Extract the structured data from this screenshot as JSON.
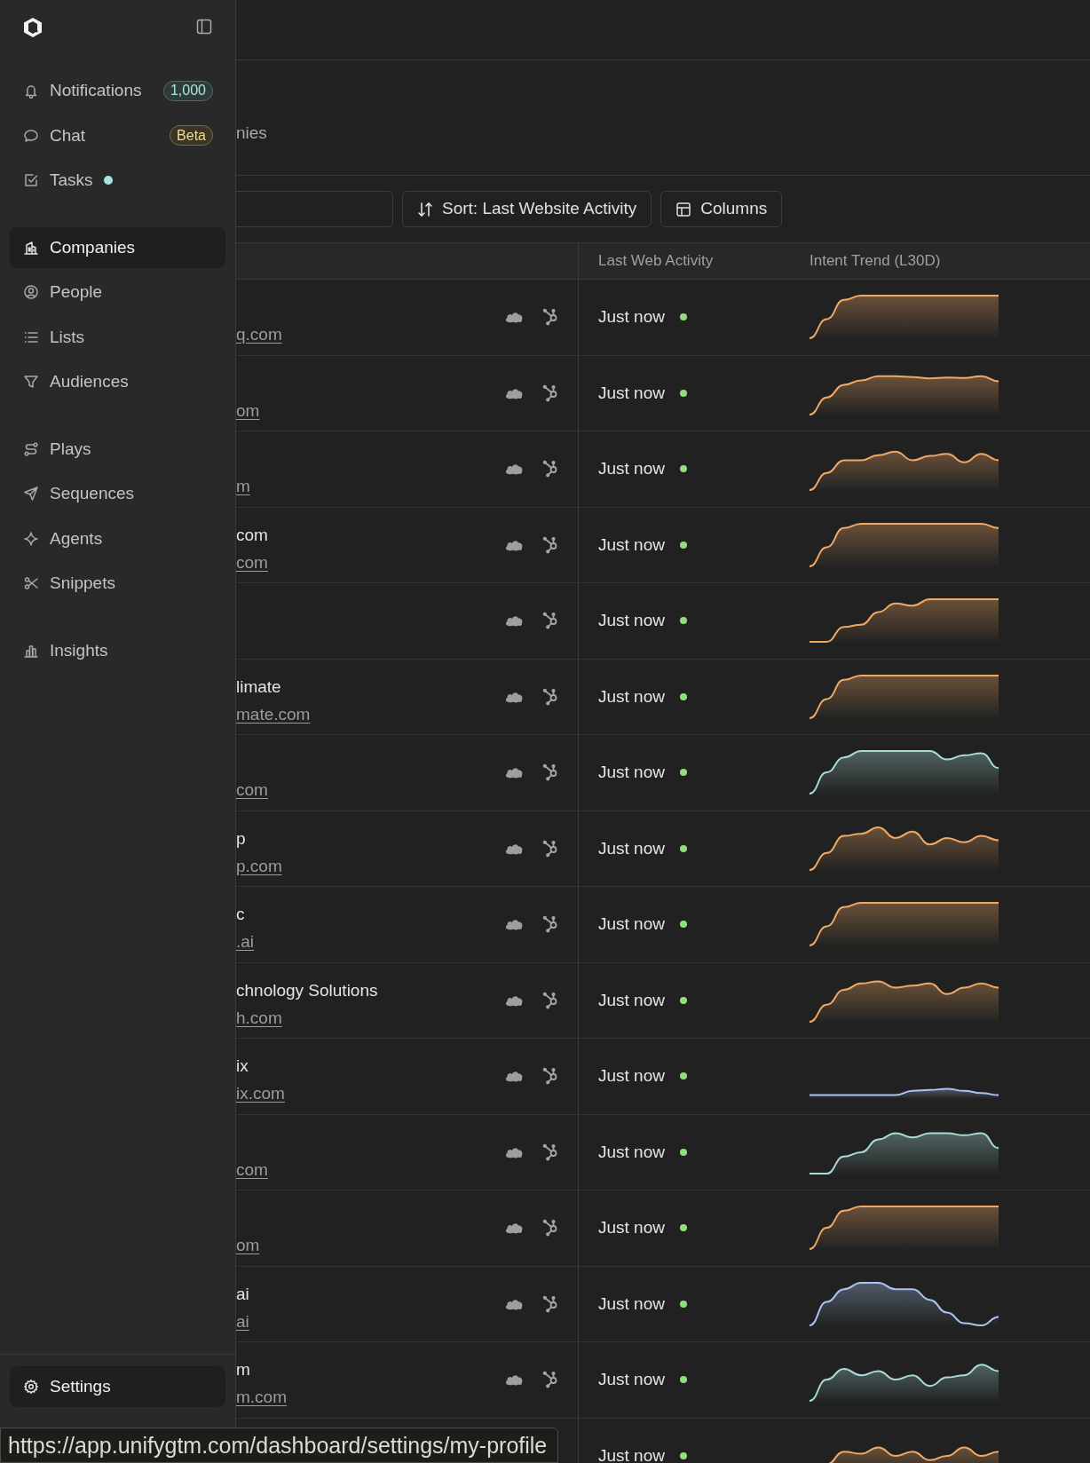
{
  "sidebar": {
    "groups": [
      [
        {
          "label": "Notifications",
          "selected": false,
          "badge": {
            "text": "1,000",
            "kind": "count"
          }
        },
        {
          "label": "Chat",
          "selected": false,
          "badge": {
            "text": "Beta",
            "kind": "beta"
          }
        },
        {
          "label": "Tasks",
          "selected": false,
          "unread": true
        }
      ],
      [
        {
          "label": "Companies",
          "selected": true
        },
        {
          "label": "People",
          "selected": false
        },
        {
          "label": "Lists",
          "selected": false
        },
        {
          "label": "Audiences",
          "selected": false
        }
      ],
      [
        {
          "label": "Plays",
          "selected": false
        },
        {
          "label": "Sequences",
          "selected": false
        },
        {
          "label": "Agents",
          "selected": false
        },
        {
          "label": "Snippets",
          "selected": false
        }
      ],
      [
        {
          "label": "Insights",
          "selected": false
        }
      ]
    ],
    "footer": {
      "label": "Settings",
      "selected": true
    }
  },
  "page": {
    "tab_fragment": "nies"
  },
  "toolbar": {
    "sort_button": "Sort: Last Website Activity",
    "columns_button": "Columns"
  },
  "table": {
    "columns": [
      "Last Web Activity",
      "Intent Trend (L30D)"
    ],
    "rows": [
      {
        "domain": "q.com",
        "last_activity": "Just now",
        "active": true,
        "trend": {
          "color": "#f0a865"
        }
      },
      {
        "domain": "om",
        "last_activity": "Just now",
        "active": true,
        "trend": {
          "color": "#f0a865"
        }
      },
      {
        "domain": "m",
        "last_activity": "Just now",
        "active": true,
        "trend": {
          "color": "#f0a865"
        }
      },
      {
        "name": "com",
        "domain": "com",
        "last_activity": "Just now",
        "active": true,
        "trend": {
          "color": "#f0a865"
        }
      },
      {
        "last_activity": "Just now",
        "active": true,
        "trend": {
          "color": "#f0a865"
        }
      },
      {
        "name": "limate",
        "domain": "mate.com",
        "last_activity": "Just now",
        "active": true,
        "trend": {
          "color": "#f0a865"
        }
      },
      {
        "domain": "com",
        "last_activity": "Just now",
        "active": true,
        "trend": {
          "color": "#a8dcd8"
        }
      },
      {
        "name": "p",
        "domain": "p.com",
        "last_activity": "Just now",
        "active": true,
        "trend": {
          "color": "#f0a865"
        }
      },
      {
        "name": "c",
        "domain": ".ai",
        "last_activity": "Just now",
        "active": true,
        "trend": {
          "color": "#f0a865"
        }
      },
      {
        "name": "chnology Solutions",
        "domain": "h.com",
        "last_activity": "Just now",
        "active": true,
        "trend": {
          "color": "#f0a865"
        }
      },
      {
        "name": "ix",
        "domain": "ix.com",
        "last_activity": "Just now",
        "active": true,
        "trend": {
          "color": "#a9c4f0"
        }
      },
      {
        "domain": "com",
        "last_activity": "Just now",
        "active": true,
        "trend": {
          "color": "#a8dcd8"
        }
      },
      {
        "domain": "om",
        "last_activity": "Just now",
        "active": true,
        "trend": {
          "color": "#f0a865"
        }
      },
      {
        "name": "ai",
        "domain": "ai",
        "last_activity": "Just now",
        "active": true,
        "trend": {
          "color": "#a9c4f0"
        }
      },
      {
        "name": "m",
        "domain": "m.com",
        "last_activity": "Just now",
        "active": true,
        "trend": {
          "color": "#a8dcd8"
        }
      },
      {
        "last_activity": "Just now",
        "active": true,
        "trend": {
          "color": "#f0a865"
        }
      }
    ]
  },
  "status_url": "https://app.unifygtm.com/dashboard/settings/my-profile"
}
